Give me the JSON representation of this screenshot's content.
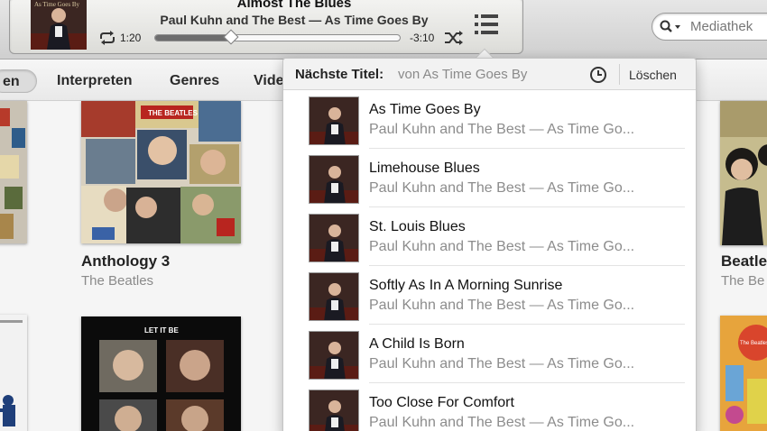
{
  "now_playing": {
    "title": "Almost The Blues",
    "artist_album": "Paul Kuhn and The Best — As Time Goes By",
    "elapsed": "1:20",
    "remaining": "-3:10",
    "progress": 0.31
  },
  "search": {
    "placeholder": "Mediathek"
  },
  "nav": {
    "tabs": [
      {
        "label": "Interpreten"
      },
      {
        "label": "Genres"
      },
      {
        "label": "Vide"
      }
    ]
  },
  "albums": [
    {
      "title": "Anthology 3",
      "artist": "The Beatles"
    },
    {
      "title": "Beatle",
      "artist": "The Be"
    }
  ],
  "up_next": {
    "heading": "Nächste Titel:",
    "context": "von As Time Goes By",
    "clear_label": "Löschen",
    "tracks": [
      {
        "title": "As Time Goes By",
        "subtitle": "Paul Kuhn and The Best — As Time Go..."
      },
      {
        "title": "Limehouse Blues",
        "subtitle": "Paul Kuhn and The Best — As Time Go..."
      },
      {
        "title": "St. Louis Blues",
        "subtitle": "Paul Kuhn and The Best — As Time Go..."
      },
      {
        "title": "Softly As In A Morning Sunrise",
        "subtitle": "Paul Kuhn and The Best — As Time Go..."
      },
      {
        "title": "A Child Is Born",
        "subtitle": "Paul Kuhn and The Best — As Time Go..."
      },
      {
        "title": "Too Close For Comfort",
        "subtitle": "Paul Kuhn and The Best — As Time Go..."
      }
    ]
  },
  "icons": {
    "repeat": "repeat-icon",
    "shuffle": "shuffle-icon",
    "up_next": "list-icon",
    "search": "search-icon",
    "history": "clock-icon"
  },
  "colors": {
    "accent": "#6d6d6d",
    "popover_header": "#f2f2f2"
  }
}
